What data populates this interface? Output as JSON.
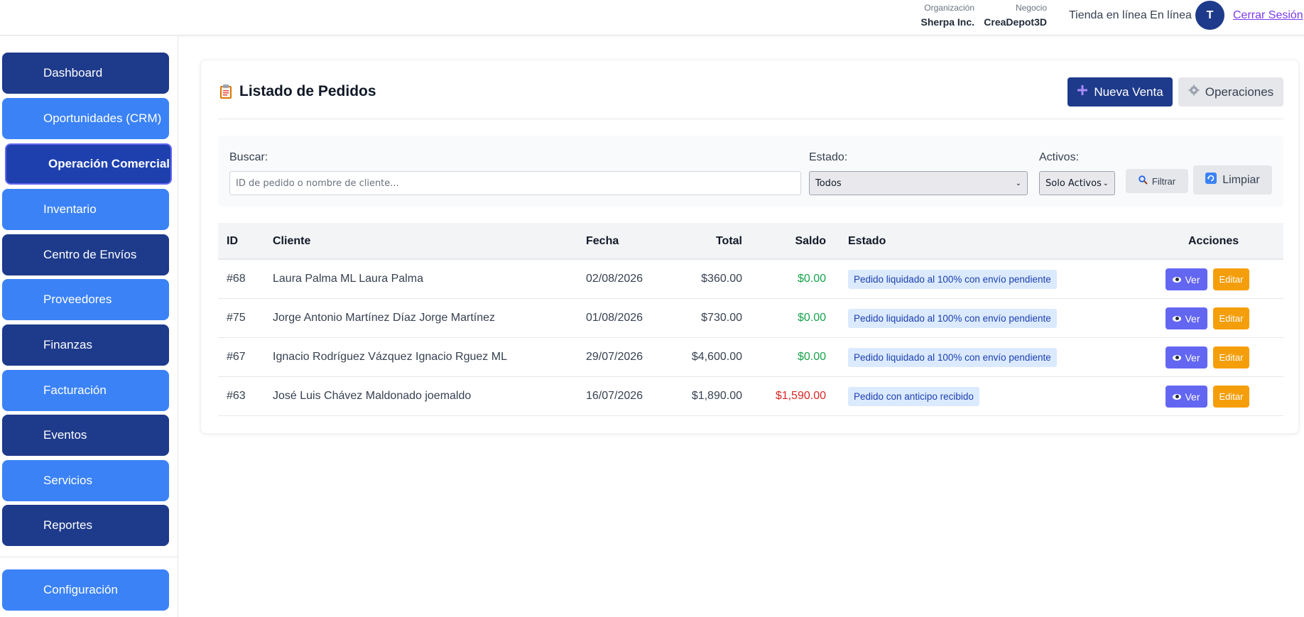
{
  "header": {
    "org_label": "Organización",
    "org_value": "Sherpa Inc.",
    "business_label": "Negocio",
    "business_value": "CreaDepot3D",
    "store_status": "Tienda en línea En línea",
    "avatar_initial": "T",
    "logout_label": "Cerrar Sesión"
  },
  "sidebar": {
    "items": [
      {
        "label": "Dashboard"
      },
      {
        "label": "Oportunidades (CRM)"
      },
      {
        "label": "Operación Comercial"
      },
      {
        "label": "Inventario"
      },
      {
        "label": "Centro de Envíos"
      },
      {
        "label": "Proveedores"
      },
      {
        "label": "Finanzas"
      },
      {
        "label": "Facturación"
      },
      {
        "label": "Eventos"
      },
      {
        "label": "Servicios"
      },
      {
        "label": "Reportes"
      }
    ],
    "settings_label": "Configuración",
    "active": "Operación Comercial"
  },
  "page": {
    "title": "Listado de Pedidos",
    "new_sale_label": "Nueva Venta",
    "operations_label": "Operaciones"
  },
  "filters": {
    "search_label": "Buscar:",
    "search_placeholder": "ID de pedido o nombre de cliente...",
    "status_label": "Estado:",
    "status_value": "Todos",
    "active_label": "Activos:",
    "active_value": "Solo Activos",
    "filter_label": "Filtrar",
    "clear_label": "Limpiar"
  },
  "table": {
    "headers": {
      "id": "ID",
      "client": "Cliente",
      "date": "Fecha",
      "total": "Total",
      "balance": "Saldo",
      "status": "Estado",
      "actions": "Acciones"
    },
    "rows": [
      {
        "id": "#68",
        "client": "Laura Palma ML Laura Palma",
        "date": "02/08/2026",
        "total": "$360.00",
        "balance": "$0.00",
        "status": "Pedido liquidado al 100% con envío pendiente",
        "view": "Ver",
        "edit": "Editar"
      },
      {
        "id": "#75",
        "client": "Jorge Antonio Martínez Díaz Jorge Martínez",
        "date": "01/08/2026",
        "total": "$730.00",
        "balance": "$0.00",
        "status": "Pedido liquidado al 100% con envío pendiente",
        "view": "Ver",
        "edit": "Editar"
      },
      {
        "id": "#67",
        "client": "Ignacio Rodríguez Vázquez Ignacio Rguez ML",
        "date": "29/07/2026",
        "total": "$4,600.00",
        "balance": "$0.00",
        "status": "Pedido liquidado al 100% con envío pendiente",
        "view": "Ver",
        "edit": "Editar"
      },
      {
        "id": "#63",
        "client": "José Luis Chávez Maldonado joemaldo",
        "date": "16/07/2026",
        "total": "$1,890.00",
        "balance": "$1,590.00",
        "status": "Pedido con anticipo recibido",
        "view": "Ver",
        "edit": "Editar"
      }
    ]
  },
  "colors": {
    "primary_dark": "#1e3a8a",
    "primary_light": "#3b82f6",
    "view_button": "#6366f1",
    "edit_button": "#f59e0b",
    "balance_zero": "#16a34a",
    "balance_due": "#dc2626"
  }
}
